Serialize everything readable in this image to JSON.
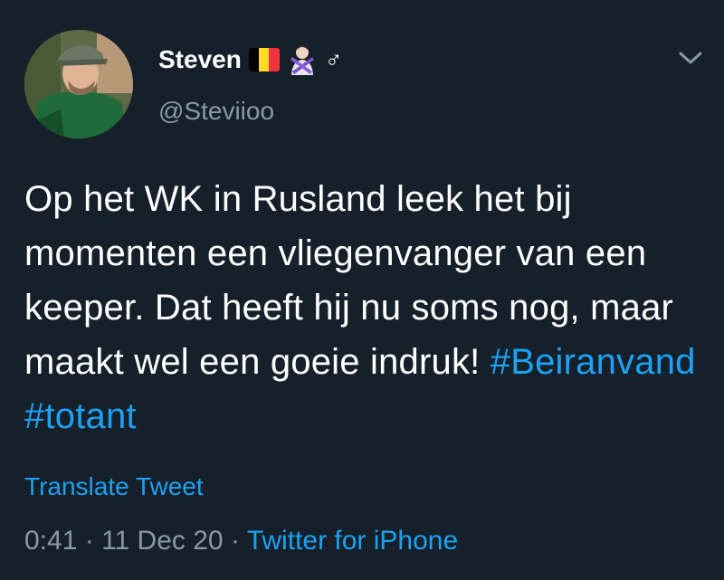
{
  "user": {
    "display_name": "Steven",
    "flag_colors": [
      "#000000",
      "#fdda24",
      "#ef3340"
    ],
    "emoji": "person-gesturing-no",
    "male_sign": "♂",
    "handle": "@Steviioo"
  },
  "tweet": {
    "text": "Op het WK in Rusland leek het bij momenten een vliegenvanger van een keeper. Dat heeft hij nu soms nog, maar maakt wel een goeie indruk! ",
    "hashtags": [
      "#Beiranvand",
      "#totant"
    ]
  },
  "translate_label": "Translate Tweet",
  "meta": {
    "time": "0:41",
    "sep1": " · ",
    "date": "11 Dec 20",
    "sep2": " · ",
    "source": "Twitter for iPhone"
  },
  "icons": {
    "more": "chevron-down-icon"
  },
  "colors": {
    "background": "#15202b",
    "accent": "#1da1f2",
    "secondary_text": "#8899a6"
  }
}
